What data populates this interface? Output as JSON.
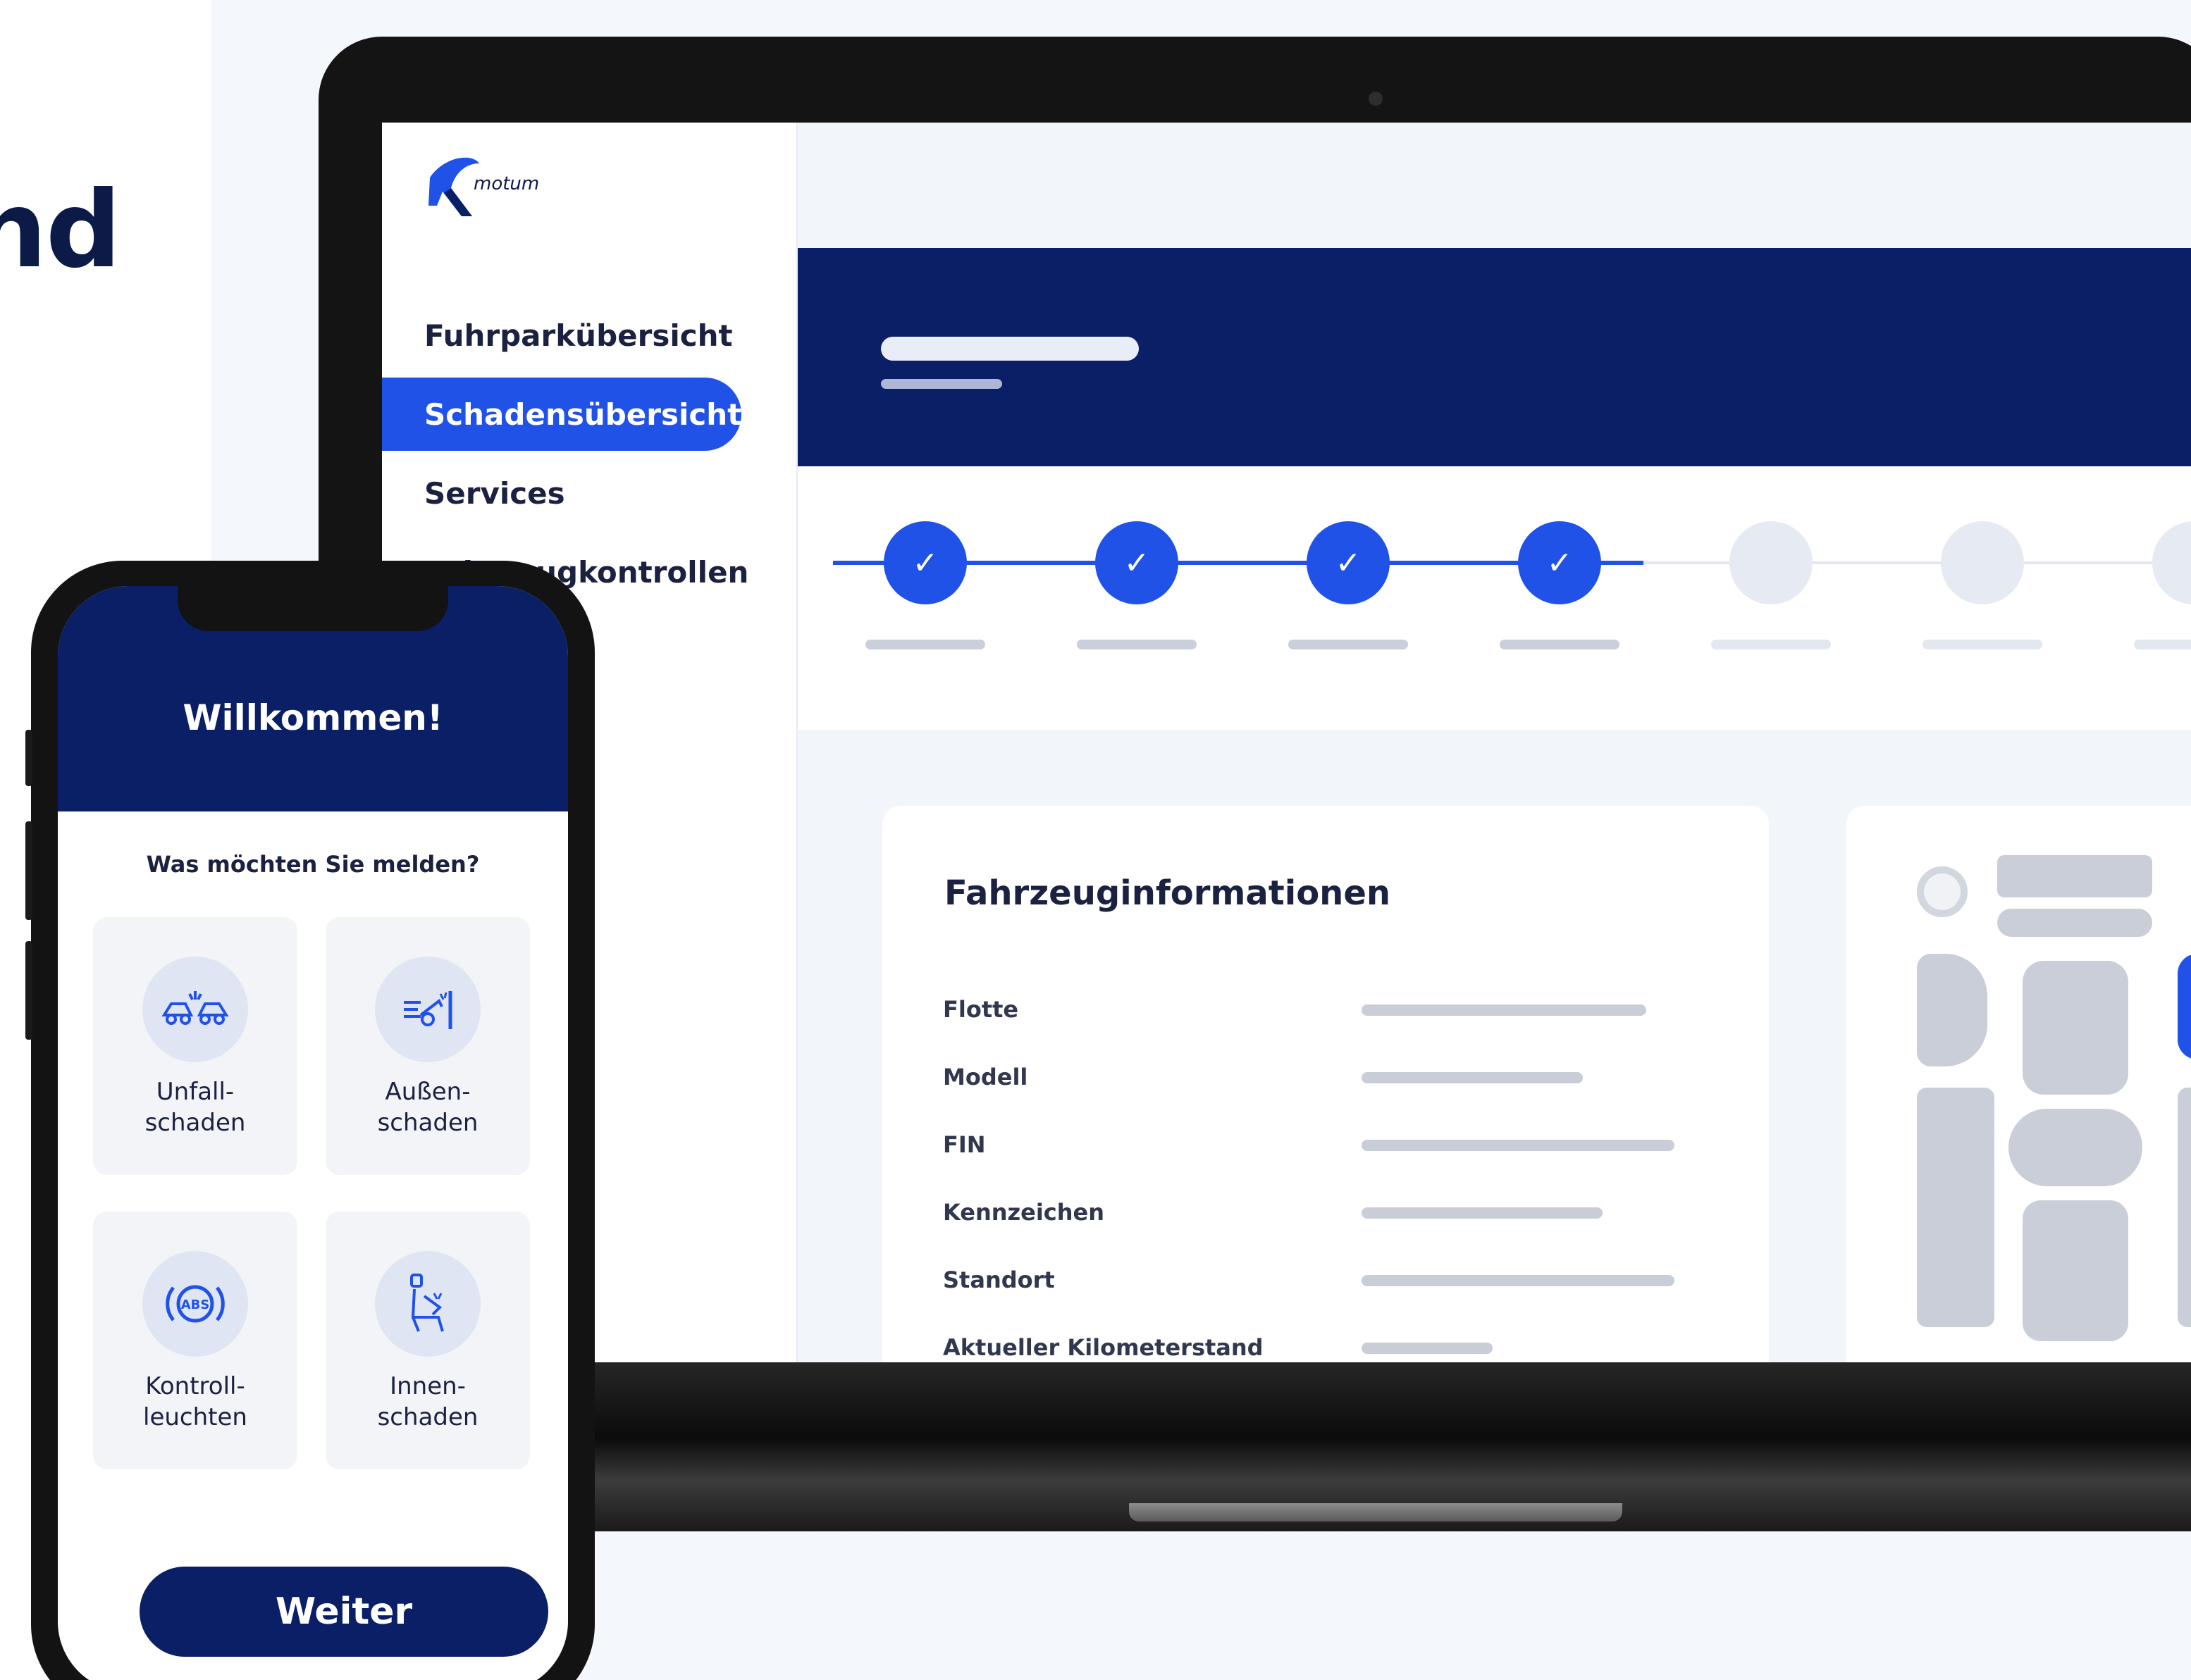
{
  "headline": "nd",
  "logo": {
    "text": "motum"
  },
  "sidebar": {
    "items": [
      {
        "label": "Fuhrparkübersicht",
        "active": false
      },
      {
        "label": "Schadensübersicht",
        "active": true
      },
      {
        "label": "Services",
        "active": false
      },
      {
        "label": "Fahrzeugkontrollen",
        "active": false
      }
    ]
  },
  "stepper": {
    "completed": 4,
    "total": 7,
    "check_glyph": "✓"
  },
  "vehicle_card": {
    "title": "Fahrzeuginformationen",
    "rows": [
      {
        "label": "Flotte"
      },
      {
        "label": "Modell"
      },
      {
        "label": "FIN"
      },
      {
        "label": "Kennzeichen"
      },
      {
        "label": "Standort"
      },
      {
        "label": "Aktueller Kilometerstand"
      }
    ]
  },
  "phone": {
    "title": "Willkommen!",
    "question": "Was möchten Sie melden?",
    "tiles": [
      {
        "label": "Unfall-\nschaden",
        "icon": "car-crash-icon"
      },
      {
        "label": "Außen-\nschaden",
        "icon": "car-exterior-damage-icon"
      },
      {
        "label": "Kontroll-\nleuchten",
        "icon": "abs-warning-light-icon",
        "icon_text": "ABS"
      },
      {
        "label": "Innen-\nschaden",
        "icon": "car-seat-icon"
      }
    ],
    "button_label": "Weiter"
  },
  "colors": {
    "navy": "#0b1f66",
    "accent_blue": "#2052e8",
    "text_dark": "#1b2140",
    "background": "#f2f5fa"
  }
}
